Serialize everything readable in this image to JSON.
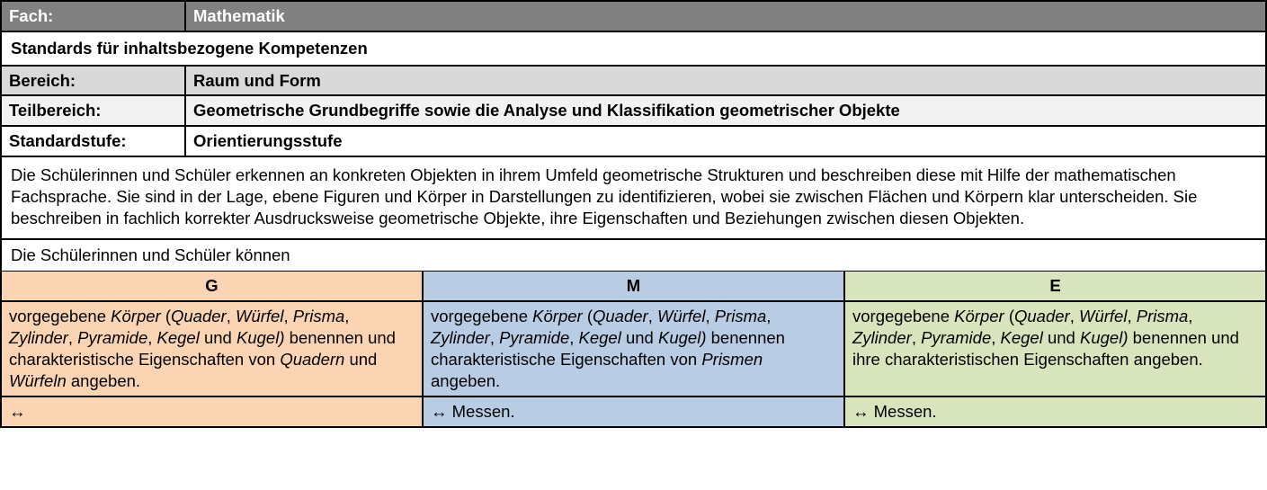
{
  "header": {
    "fach_label": "Fach:",
    "fach_value": "Mathematik",
    "standards_title": "Standards für inhaltsbezogene Kompetenzen",
    "bereich_label": "Bereich:",
    "bereich_value": "Raum und Form",
    "teilbereich_label": "Teilbereich:",
    "teilbereich_value": "Geometrische Grundbegriffe sowie die Analyse und Klassifikation geometrischer Objekte",
    "standardstufe_label": "Standardstufe:",
    "standardstufe_value": "Orientierungsstufe"
  },
  "description": "Die Schülerinnen und Schüler erkennen an konkreten Objekten in ihrem Umfeld geometrische Strukturen und beschreiben diese mit Hilfe der mathematischen Fachsprache. Sie sind in der Lage, ebene Figuren und Körper in Darstellungen zu identifizieren, wobei sie zwischen Flächen und Körpern klar unterscheiden. Sie beschreiben in fachlich korrekter Ausdrucksweise geometrische Objekte, ihre Eigenschaften und Beziehun­gen zwischen diesen Objekten.",
  "intro": "Die Schülerinnen und Schüler können",
  "gme": {
    "g": {
      "label": "G"
    },
    "m": {
      "label": "M"
    },
    "e": {
      "label": "E"
    }
  },
  "body": {
    "g_pre": "vorgegebene ",
    "g_k": "Körper",
    "g_paren_open": " (",
    "g_list": "Quader",
    "g_c1": ", ",
    "g_w": "Würfel",
    "g_c2": ", ",
    "g_p": "Prisma",
    "g_c3": ", ",
    "g_z": "Zylinder",
    "g_c4": ", ",
    "g_py": "Pyramide",
    "g_c5": ", ",
    "g_ke": "Kegel",
    "g_und": " und ",
    "g_ku": "Kugel)",
    "g_mid": " benen­nen und charakteristische Eigenschaften von ",
    "g_q2": "Quadern",
    "g_und2": " und ",
    "g_w2": "Würfeln",
    "g_end": " angeben.",
    "m_mid": " benen­nen charakteristische Eigenschaften von ",
    "m_pr": "Prismen",
    "m_end": " angeben.",
    "e_mid": " benen­nen und ihre charakteristischen Eigenschaften angeben."
  },
  "foot": {
    "arrow": "↔",
    "g": "",
    "m": " Messen.",
    "e": " Messen."
  }
}
